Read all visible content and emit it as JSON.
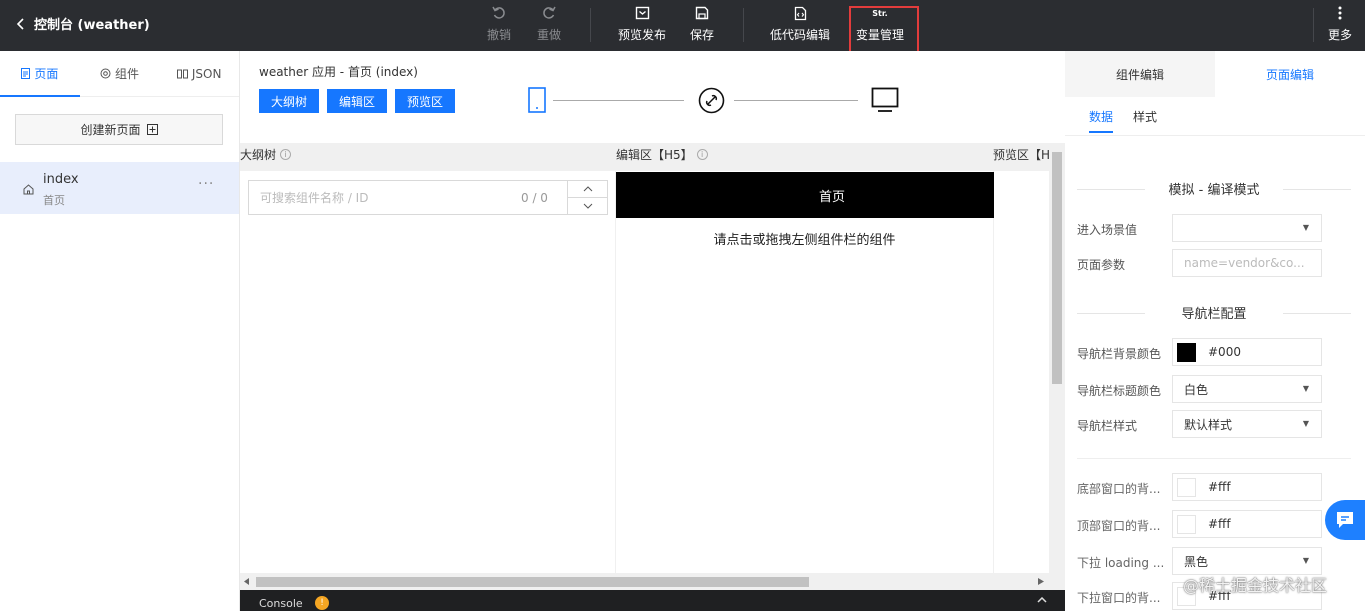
{
  "topbar": {
    "back_title": "控制台 (weather)",
    "undo_label": "撤销",
    "redo_label": "重做",
    "preview_publish_label": "预览发布",
    "save_label": "保存",
    "lowcode_label": "低代码编辑",
    "var_icon_text": "Str.",
    "var_manage_label": "变量管理",
    "more_label": "更多"
  },
  "left": {
    "tabs": [
      "页面",
      "组件",
      "JSON"
    ],
    "new_page_label": "创建新页面",
    "page": {
      "name": "index",
      "subtitle": "首页",
      "more": "···"
    }
  },
  "center": {
    "breadcrumb": "weather 应用 - 首页 (index)",
    "buttons": [
      "大纲树",
      "编辑区",
      "预览区"
    ],
    "col_outline": "大纲树",
    "col_editor": "编辑区【H5】",
    "col_preview": "预览区【H",
    "search_placeholder": "可搜索组件名称 / ID",
    "search_count": "0 / 0",
    "navbar_title": "首页",
    "hint": "请点击或拖拽左侧组件栏的组件",
    "console_label": "Console",
    "console_badge": "!"
  },
  "right": {
    "tabs": [
      "组件编辑",
      "页面编辑"
    ],
    "subtabs": [
      "数据",
      "样式"
    ],
    "section1": "模拟 - 编译模式",
    "scene_label": "进入场景值",
    "scene_value": "",
    "params_label": "页面参数",
    "params_placeholder": "name=vendor&co...",
    "section2": "导航栏配置",
    "nav_bg_label": "导航栏背景颜色",
    "nav_bg_value": "#000",
    "nav_title_color_label": "导航栏标题颜色",
    "nav_title_color_value": "白色",
    "nav_style_label": "导航栏样式",
    "nav_style_value": "默认样式",
    "bottom_bg_label": "底部窗口的背...",
    "bottom_bg_value": "#fff",
    "top_bg_label": "顶部窗口的背...",
    "top_bg_value": "#fff",
    "pull_loading_label": "下拉 loading ...",
    "pull_loading_value": "黑色",
    "pull_bg_label": "下拉窗口的背...",
    "pull_bg_value": "#fff"
  },
  "watermark": "@稀土掘金技术社区",
  "colors": {
    "accent": "#1677ff",
    "topbar": "#2b2d31",
    "highlight": "#e23c3c"
  }
}
